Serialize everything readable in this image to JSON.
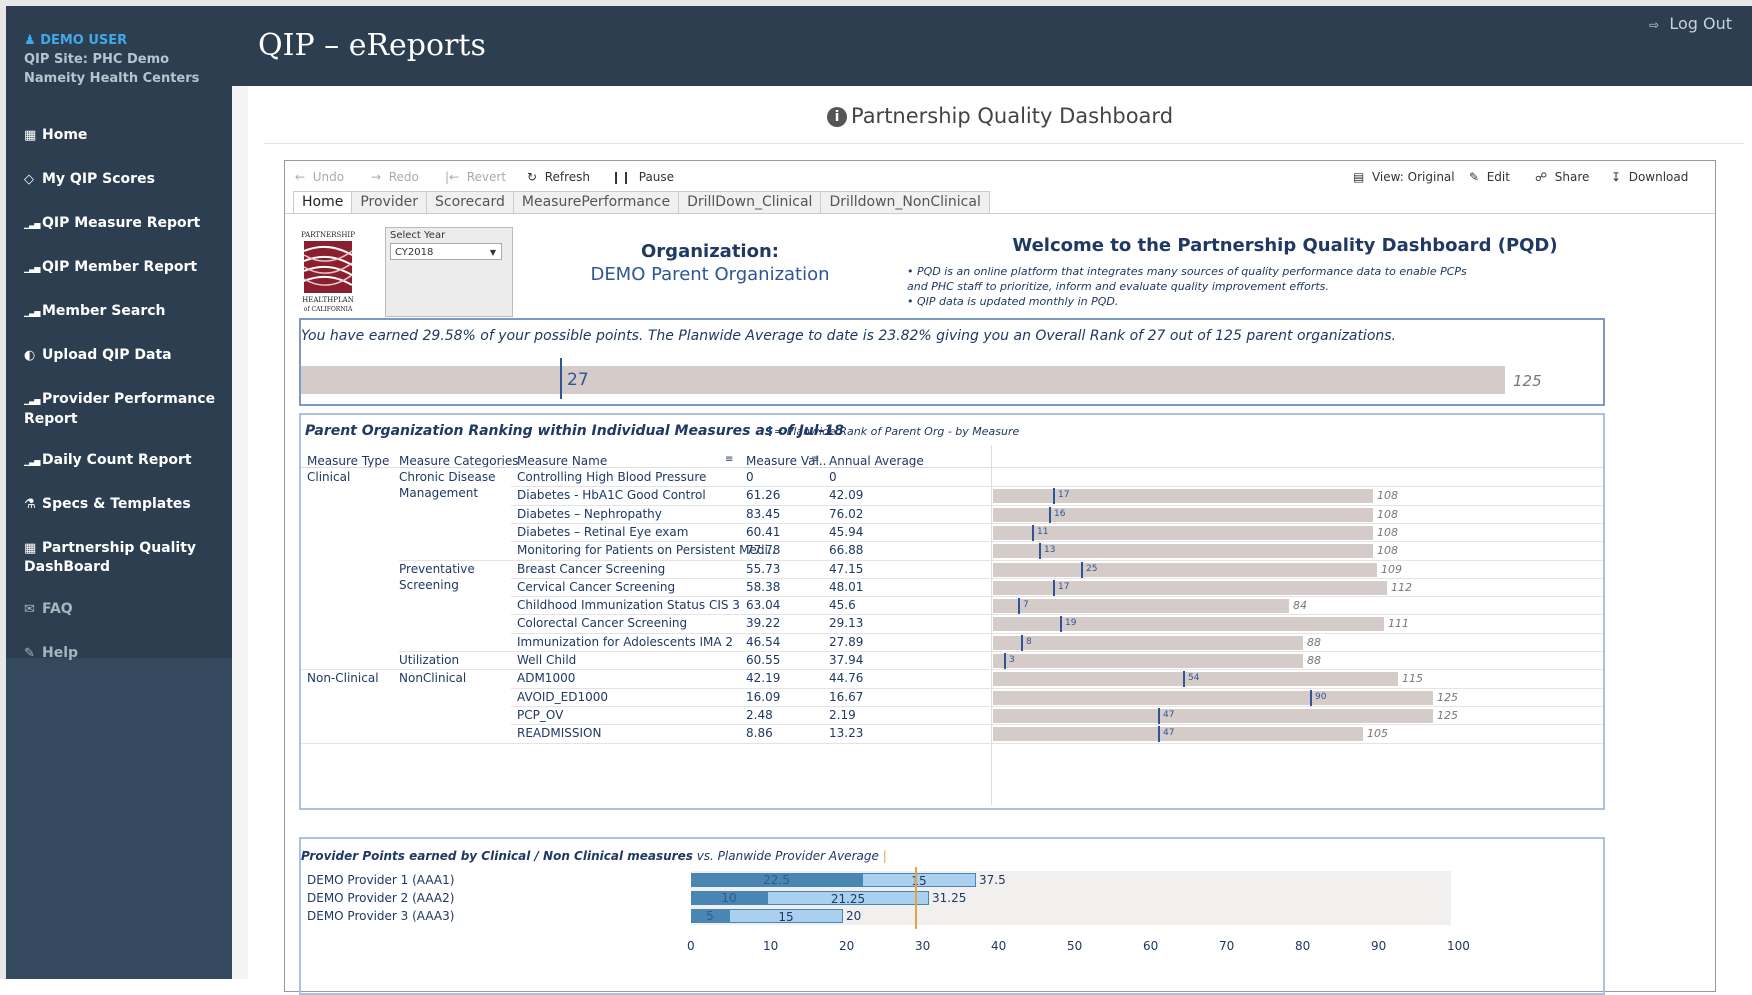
{
  "user": {
    "name": "DEMO USER",
    "site": "QIP Site: PHC Demo",
    "org": "Nameity Health Centers"
  },
  "nav": [
    {
      "icon": "home-icon",
      "label": "Home"
    },
    {
      "icon": "diamond-icon",
      "label": "My QIP Scores"
    },
    {
      "icon": "bar-chart-icon",
      "label": "QIP Measure Report"
    },
    {
      "icon": "bar-chart-icon",
      "label": "QIP Member Report"
    },
    {
      "icon": "bar-chart-icon",
      "label": "Member Search"
    },
    {
      "icon": "upload-icon",
      "label": "Upload QIP Data"
    },
    {
      "icon": "bar-chart-icon",
      "label": "Provider Performance Report"
    },
    {
      "icon": "bar-chart-icon",
      "label": "Daily Count Report"
    },
    {
      "icon": "flask-icon",
      "label": "Specs & Templates"
    },
    {
      "icon": "grid-icon",
      "label": "Partnership Quality DashBoard"
    },
    {
      "icon": "envelope-icon",
      "label": "FAQ"
    },
    {
      "icon": "edit-icon",
      "label": "Help"
    }
  ],
  "header": {
    "app_title": "QIP – eReports",
    "logout": "Log Out"
  },
  "dashboard": {
    "title": "Partnership Quality Dashboard"
  },
  "toolbar": {
    "undo": "Undo",
    "redo": "Redo",
    "revert": "Revert",
    "refresh": "Refresh",
    "pause": "Pause",
    "view": "View: Original",
    "edit": "Edit",
    "share": "Share",
    "download": "Download"
  },
  "tabs": [
    "Home",
    "Provider",
    "Scorecard",
    "MeasurePerformance",
    "DrillDown_Clinical",
    "Drilldown_NonClinical"
  ],
  "logo_text": {
    "top": "PARTNERSHIP",
    "mid": "HEALTHPLAN",
    "bottom": "of CALIFORNIA"
  },
  "year_filter": {
    "label": "Select Year",
    "value": "CY2018"
  },
  "org": {
    "label": "Organization:",
    "name": "DEMO Parent Organization"
  },
  "welcome": {
    "title": "Welcome to the Partnership Quality Dashboard (PQD)",
    "bullet1": "• PQD is an online platform that integrates many sources of quality performance data to enable PCPs and PHC staff to prioritize, inform and evaluate quality improvement efforts.",
    "bullet2": "• QIP data is updated monthly in PQD."
  },
  "earned": {
    "text": "You have earned 29.58% of your possible points. The Planwide Average to date is 23.82% giving you an Overall Rank of  27 out of 125 parent organizations.",
    "rank": 27,
    "total": 125
  },
  "measures": {
    "title": "Parent Organization Ranking within Individual Measures as of Jul-18",
    "legend": "= Planwide Rank of Parent Org - by Measure",
    "headers": {
      "type": "Measure Type",
      "category": "Measure Categories",
      "name": "Measure Name",
      "value": "Measure Val..",
      "avg": "Annual Average"
    },
    "rows": [
      {
        "type": "Clinical",
        "category": "Chronic Disease",
        "category2": "Management",
        "name": "Controlling High Blood Pressure",
        "value": "0",
        "avg": "0",
        "rank": null,
        "max": null
      },
      {
        "type": "",
        "category": "",
        "category2": "",
        "name": "Diabetes - HbA1C Good Control",
        "value": "61.26",
        "avg": "42.09",
        "rank": 17,
        "max": 108
      },
      {
        "type": "",
        "category": "",
        "category2": "",
        "name": "Diabetes – Nephropathy",
        "value": "83.45",
        "avg": "76.02",
        "rank": 16,
        "max": 108
      },
      {
        "type": "",
        "category": "",
        "category2": "",
        "name": "Diabetes – Retinal Eye exam",
        "value": "60.41",
        "avg": "45.94",
        "rank": 11,
        "max": 108
      },
      {
        "type": "",
        "category": "",
        "category2": "",
        "name": "Monitoring for Patients on Persistent Medi..",
        "value": "77.78",
        "avg": "66.88",
        "rank": 13,
        "max": 108
      },
      {
        "type": "",
        "category": "Preventative",
        "category2": "Screening",
        "name": "Breast Cancer Screening",
        "value": "55.73",
        "avg": "47.15",
        "rank": 25,
        "max": 109
      },
      {
        "type": "",
        "category": "",
        "category2": "",
        "name": "Cervical Cancer Screening",
        "value": "58.38",
        "avg": "48.01",
        "rank": 17,
        "max": 112
      },
      {
        "type": "",
        "category": "",
        "category2": "",
        "name": "Childhood Immunization Status CIS 3",
        "value": "63.04",
        "avg": "45.6",
        "rank": 7,
        "max": 84
      },
      {
        "type": "",
        "category": "",
        "category2": "",
        "name": "Colorectal Cancer Screening",
        "value": "39.22",
        "avg": "29.13",
        "rank": 19,
        "max": 111
      },
      {
        "type": "",
        "category": "",
        "category2": "",
        "name": "Immunization for Adolescents IMA 2",
        "value": "46.54",
        "avg": "27.89",
        "rank": 8,
        "max": 88
      },
      {
        "type": "",
        "category": "Utilization",
        "category2": "",
        "name": "Well Child",
        "value": "60.55",
        "avg": "37.94",
        "rank": 3,
        "max": 88
      },
      {
        "type": "Non-Clinical",
        "category": "NonClinical",
        "category2": "",
        "name": "ADM1000",
        "value": "42.19",
        "avg": "44.76",
        "rank": 54,
        "max": 115
      },
      {
        "type": "",
        "category": "",
        "category2": "",
        "name": "AVOID_ED1000",
        "value": "16.09",
        "avg": "16.67",
        "rank": 90,
        "max": 125
      },
      {
        "type": "",
        "category": "",
        "category2": "",
        "name": "PCP_OV",
        "value": "2.48",
        "avg": "2.19",
        "rank": 47,
        "max": 125
      },
      {
        "type": "",
        "category": "",
        "category2": "",
        "name": "READMISSION",
        "value": "8.86",
        "avg": "13.23",
        "rank": 47,
        "max": 105
      }
    ]
  },
  "providers": {
    "title_a": "Provider Points earned by Clinical / Non Clinical measures",
    "title_b": "vs. Planwide  Provider Average",
    "planwide_avg": 29.5,
    "rows": [
      {
        "name": "DEMO Provider 1 (AAA1)",
        "clinical": 22.5,
        "nonclinical": 15,
        "total": "37.5",
        "clinical_label": "22.5",
        "nonclinical_label": "15"
      },
      {
        "name": "DEMO Provider 2 (AAA2)",
        "clinical": 10,
        "nonclinical": 21.25,
        "total": "31.25",
        "clinical_label": "10",
        "nonclinical_label": "21.25"
      },
      {
        "name": "DEMO Provider 3 (AAA3)",
        "clinical": 5,
        "nonclinical": 15,
        "total": "20",
        "clinical_label": "5",
        "nonclinical_label": "15"
      }
    ],
    "axis": [
      "0",
      "10",
      "20",
      "30",
      "40",
      "50",
      "60",
      "70",
      "80",
      "90",
      "100"
    ]
  },
  "colors": {
    "sidebar": "#2c3e50",
    "rank_marker": "#2f5597",
    "rank_bar": "#d5cbc8",
    "clinical": "#4a86b4",
    "nonclinical": "#a9d1ef",
    "average": "#e8a33a"
  }
}
